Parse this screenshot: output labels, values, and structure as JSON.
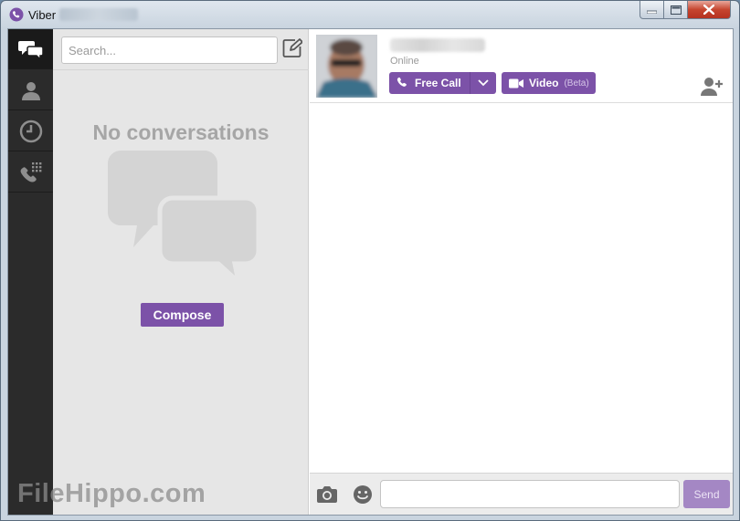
{
  "window": {
    "title": "Viber",
    "controls": [
      "minimize-icon",
      "maximize-icon",
      "close-icon"
    ]
  },
  "nav": {
    "items": [
      {
        "icon": "chat-bubbles-icon",
        "active": true
      },
      {
        "icon": "contacts-icon",
        "active": false
      },
      {
        "icon": "recents-clock-icon",
        "active": false
      },
      {
        "icon": "dialpad-icon",
        "active": false
      }
    ]
  },
  "conversations": {
    "search_placeholder": "Search...",
    "empty_title": "No conversations",
    "compose_label": "Compose"
  },
  "contact": {
    "status": "Online",
    "free_call_label": "Free Call",
    "video_label": "Video",
    "video_badge": "(Beta)"
  },
  "composer": {
    "send_label": "Send"
  },
  "watermark": {
    "text": "FileHippo.com"
  },
  "colors": {
    "accent": "#7c52a8",
    "nav_bg": "#2b2b2b",
    "panel_bg": "#e6e6e6"
  }
}
